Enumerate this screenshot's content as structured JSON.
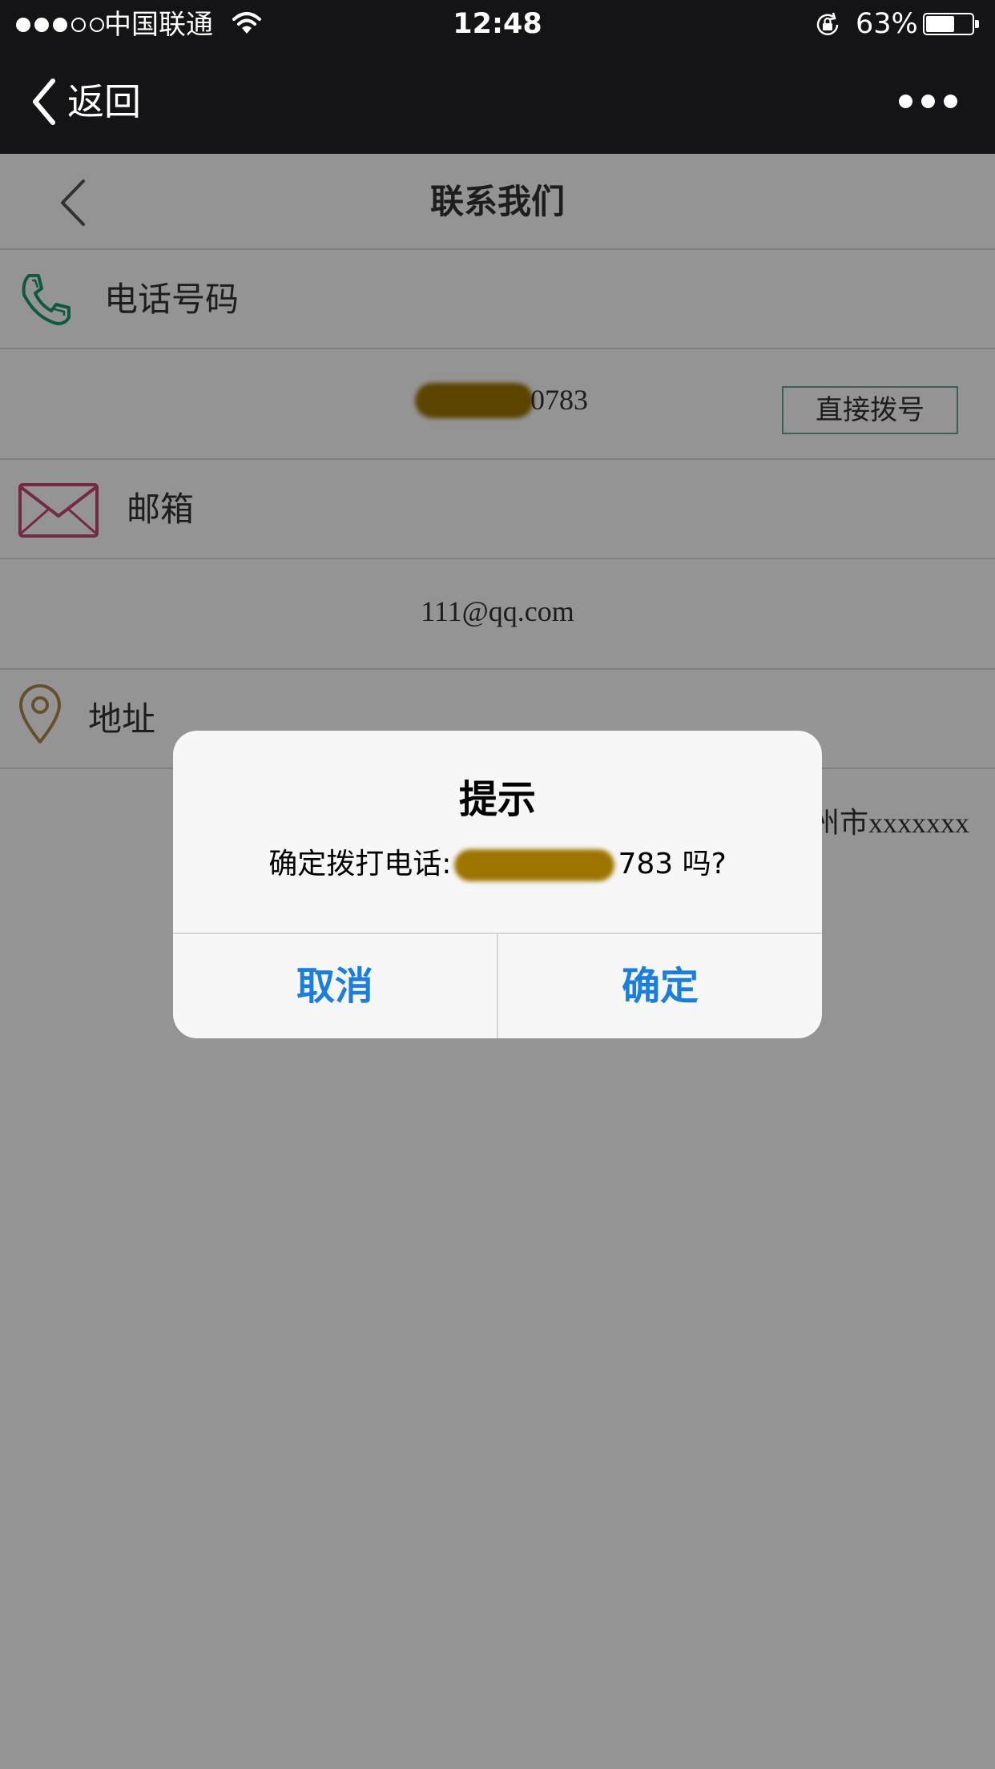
{
  "status_bar": {
    "signal_dots": [
      true,
      true,
      true,
      false,
      false
    ],
    "carrier": "中国联通",
    "time": "12:48",
    "battery_percent_label": "63%",
    "battery_level": 0.63,
    "icons": [
      "wifi-icon",
      "rotation-lock-icon",
      "battery-icon"
    ]
  },
  "nav": {
    "back_label": "返回",
    "more_icon": "more-dots-icon"
  },
  "page": {
    "title": "联系我们",
    "sections": {
      "phone": {
        "label": "电话号码",
        "icon": "phone-icon",
        "icon_color": "#1a9a6e",
        "value_visible": "0783",
        "dial_button": "直接拨号"
      },
      "email": {
        "label": "邮箱",
        "icon": "envelope-icon",
        "icon_color": "#c8477a",
        "value": "111@qq.com"
      },
      "address": {
        "label": "地址",
        "icon": "location-pin-icon",
        "icon_color": "#b08a4a",
        "value_visible": "州市xxxxxxx"
      }
    }
  },
  "alert": {
    "title": "提示",
    "message_prefix": "确定拨打电话:",
    "message_suffix": "783 吗?",
    "cancel_label": "取消",
    "confirm_label": "确定",
    "button_color": "#1a7ee0"
  }
}
